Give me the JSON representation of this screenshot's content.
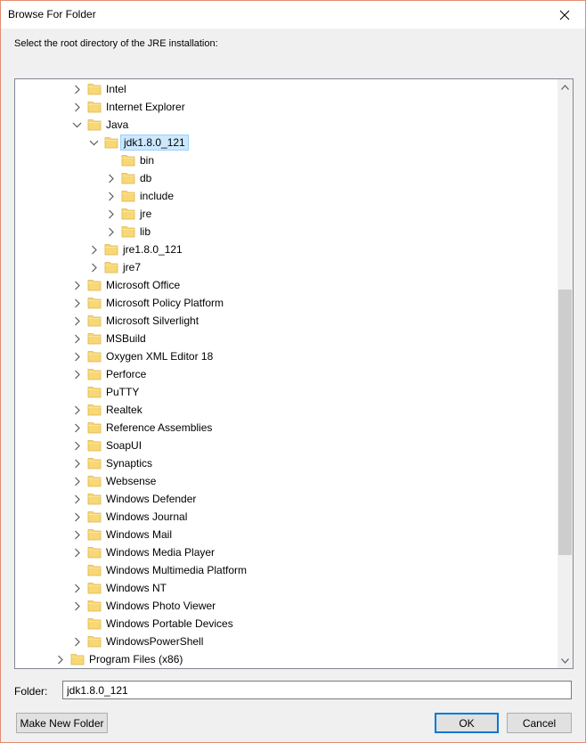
{
  "window": {
    "title": "Browse For Folder"
  },
  "instructions": "Select the root directory of the JRE installation:",
  "tree": {
    "selected": "jdk1.8.0_121",
    "items": [
      {
        "label": "Intel",
        "level": 2,
        "expander": "collapsed"
      },
      {
        "label": "Internet Explorer",
        "level": 2,
        "expander": "collapsed"
      },
      {
        "label": "Java",
        "level": 2,
        "expander": "expanded"
      },
      {
        "label": "jdk1.8.0_121",
        "level": 3,
        "expander": "expanded",
        "selected": true
      },
      {
        "label": "bin",
        "level": 4,
        "expander": "none"
      },
      {
        "label": "db",
        "level": 4,
        "expander": "collapsed"
      },
      {
        "label": "include",
        "level": 4,
        "expander": "collapsed"
      },
      {
        "label": "jre",
        "level": 4,
        "expander": "collapsed"
      },
      {
        "label": "lib",
        "level": 4,
        "expander": "collapsed"
      },
      {
        "label": "jre1.8.0_121",
        "level": 3,
        "expander": "collapsed"
      },
      {
        "label": "jre7",
        "level": 3,
        "expander": "collapsed"
      },
      {
        "label": "Microsoft Office",
        "level": 2,
        "expander": "collapsed"
      },
      {
        "label": "Microsoft Policy Platform",
        "level": 2,
        "expander": "collapsed"
      },
      {
        "label": "Microsoft Silverlight",
        "level": 2,
        "expander": "collapsed"
      },
      {
        "label": "MSBuild",
        "level": 2,
        "expander": "collapsed"
      },
      {
        "label": "Oxygen XML Editor 18",
        "level": 2,
        "expander": "collapsed"
      },
      {
        "label": "Perforce",
        "level": 2,
        "expander": "collapsed"
      },
      {
        "label": "PuTTY",
        "level": 2,
        "expander": "none"
      },
      {
        "label": "Realtek",
        "level": 2,
        "expander": "collapsed"
      },
      {
        "label": "Reference Assemblies",
        "level": 2,
        "expander": "collapsed"
      },
      {
        "label": "SoapUI",
        "level": 2,
        "expander": "collapsed"
      },
      {
        "label": "Synaptics",
        "level": 2,
        "expander": "collapsed"
      },
      {
        "label": "Websense",
        "level": 2,
        "expander": "collapsed"
      },
      {
        "label": "Windows Defender",
        "level": 2,
        "expander": "collapsed"
      },
      {
        "label": "Windows Journal",
        "level": 2,
        "expander": "collapsed"
      },
      {
        "label": "Windows Mail",
        "level": 2,
        "expander": "collapsed"
      },
      {
        "label": "Windows Media Player",
        "level": 2,
        "expander": "collapsed"
      },
      {
        "label": "Windows Multimedia Platform",
        "level": 2,
        "expander": "none"
      },
      {
        "label": "Windows NT",
        "level": 2,
        "expander": "collapsed"
      },
      {
        "label": "Windows Photo Viewer",
        "level": 2,
        "expander": "collapsed"
      },
      {
        "label": "Windows Portable Devices",
        "level": 2,
        "expander": "none"
      },
      {
        "label": "WindowsPowerShell",
        "level": 2,
        "expander": "collapsed"
      },
      {
        "label": "Program Files (x86)",
        "level": 1,
        "expander": "collapsed"
      }
    ]
  },
  "folder_field": {
    "label": "Folder:",
    "value": "jdk1.8.0_121"
  },
  "buttons": {
    "make_new_folder": "Make New Folder",
    "ok": "OK",
    "cancel": "Cancel"
  },
  "icons": {
    "folder": "folder-icon",
    "close": "close-icon",
    "expander": "chevron-icon"
  },
  "colors": {
    "selection_bg": "#cce8ff",
    "selection_border": "#99d1ff",
    "folder": "#f8d775",
    "accent": "#0078d7"
  }
}
